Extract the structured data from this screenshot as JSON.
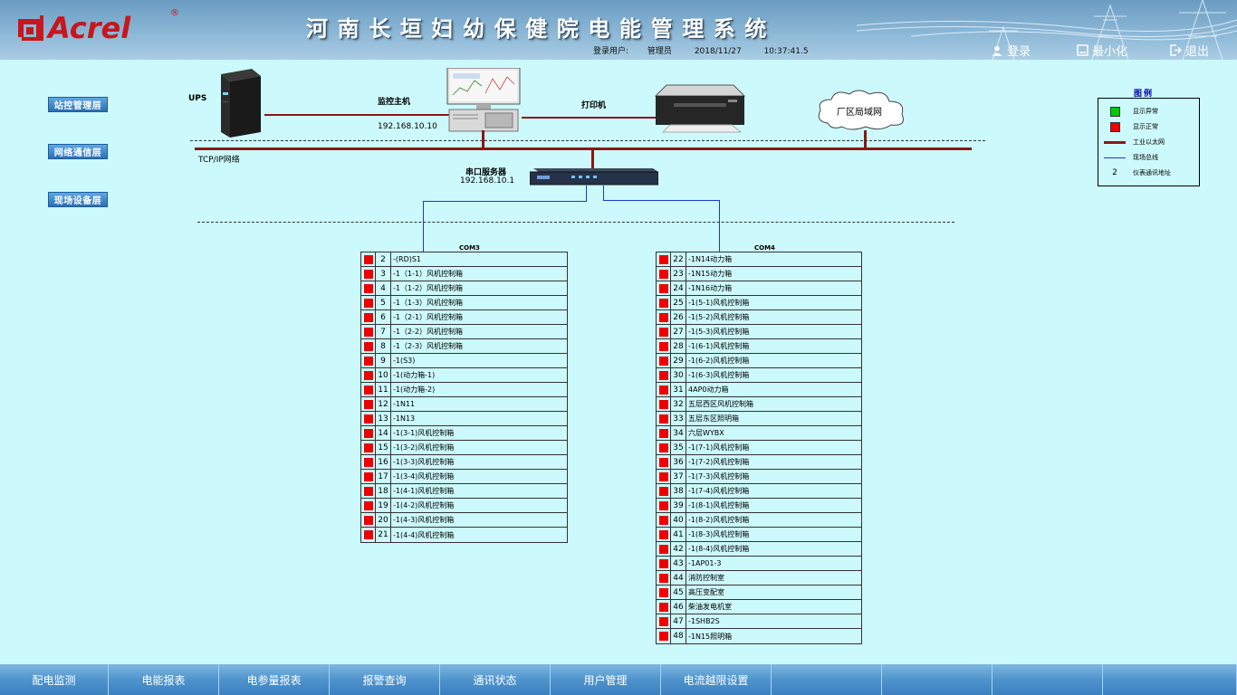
{
  "header": {
    "logo_text": "Acrel",
    "logo_reg": "®",
    "title": "河南长垣妇幼保健院电能管理系统",
    "login_user_label": "登录用户:",
    "login_user": "管理员",
    "date": "2018/11/27",
    "time": "10:37:41.5",
    "buttons": {
      "login": "登录",
      "minimize": "最小化",
      "logout": "退出"
    }
  },
  "layers": [
    "站控管理层",
    "网络通信层",
    "现场设备层"
  ],
  "topology": {
    "ups_label": "UPS",
    "host_label": "监控主机",
    "host_ip": "192.168.10.10",
    "printer_label": "打印机",
    "lan_label": "厂区局域网",
    "tcpip_label": "TCP/IP网络",
    "server_label": "串口服务器",
    "server_ip": "192.168.10.1"
  },
  "com_left": {
    "label": "COM3",
    "rows": [
      {
        "no": "2",
        "name": "-(RD)S1"
      },
      {
        "no": "3",
        "name": "-1（1-1）风机控制箱"
      },
      {
        "no": "4",
        "name": "-1（1-2）风机控制箱"
      },
      {
        "no": "5",
        "name": "-1（1-3）风机控制箱"
      },
      {
        "no": "6",
        "name": "-1（2-1）风机控制箱"
      },
      {
        "no": "7",
        "name": "-1（2-2）风机控制箱"
      },
      {
        "no": "8",
        "name": "-1（2-3）风机控制箱"
      },
      {
        "no": "9",
        "name": "-1(S3)"
      },
      {
        "no": "10",
        "name": "-1(动力箱-1)"
      },
      {
        "no": "11",
        "name": "-1(动力箱-2)"
      },
      {
        "no": "12",
        "name": "-1N11"
      },
      {
        "no": "13",
        "name": "-1N13"
      },
      {
        "no": "14",
        "name": "-1(3-1)风机控制箱"
      },
      {
        "no": "15",
        "name": "-1(3-2)风机控制箱"
      },
      {
        "no": "16",
        "name": "-1(3-3)风机控制箱"
      },
      {
        "no": "17",
        "name": "-1(3-4)风机控制箱"
      },
      {
        "no": "18",
        "name": "-1(4-1)风机控制箱"
      },
      {
        "no": "19",
        "name": "-1(4-2)风机控制箱"
      },
      {
        "no": "20",
        "name": "-1(4-3)风机控制箱"
      },
      {
        "no": "21",
        "name": "-1(4-4)风机控制箱"
      }
    ]
  },
  "com_right": {
    "label": "COM4",
    "rows": [
      {
        "no": "22",
        "name": "-1N14动力箱"
      },
      {
        "no": "23",
        "name": "-1N15动力箱"
      },
      {
        "no": "24",
        "name": "-1N16动力箱"
      },
      {
        "no": "25",
        "name": "-1(5-1)风机控制箱"
      },
      {
        "no": "26",
        "name": "-1(5-2)风机控制箱"
      },
      {
        "no": "27",
        "name": "-1(5-3)风机控制箱"
      },
      {
        "no": "28",
        "name": "-1(6-1)风机控制箱"
      },
      {
        "no": "29",
        "name": "-1(6-2)风机控制箱"
      },
      {
        "no": "30",
        "name": "-1(6-3)风机控制箱"
      },
      {
        "no": "31",
        "name": "4AP0动力箱"
      },
      {
        "no": "32",
        "name": "五层西区风机控制箱"
      },
      {
        "no": "33",
        "name": "五层东区照明箱"
      },
      {
        "no": "34",
        "name": "六层WYBX"
      },
      {
        "no": "35",
        "name": "-1(7-1)风机控制箱"
      },
      {
        "no": "36",
        "name": "-1(7-2)风机控制箱"
      },
      {
        "no": "37",
        "name": "-1(7-3)风机控制箱"
      },
      {
        "no": "38",
        "name": "-1(7-4)风机控制箱"
      },
      {
        "no": "39",
        "name": "-1(8-1)风机控制箱"
      },
      {
        "no": "40",
        "name": "-1(8-2)风机控制箱"
      },
      {
        "no": "41",
        "name": "-1(8-3)风机控制箱"
      },
      {
        "no": "42",
        "name": "-1(8-4)风机控制箱"
      },
      {
        "no": "43",
        "name": "-1AP01-3"
      },
      {
        "no": "44",
        "name": "消防控制室"
      },
      {
        "no": "45",
        "name": "高压变配室"
      },
      {
        "no": "46",
        "name": "柴油发电机室"
      },
      {
        "no": "47",
        "name": "-1SHB2S"
      },
      {
        "no": "48",
        "name": "-1N15照明箱"
      }
    ]
  },
  "legend": {
    "title": "图例",
    "items": [
      {
        "symbol": "green-square",
        "label": "显示异常"
      },
      {
        "symbol": "red-square",
        "label": "显示正常"
      },
      {
        "symbol": "red-line",
        "label": "工业以太网"
      },
      {
        "symbol": "blue-line",
        "label": "现场总线"
      },
      {
        "symbol": "2",
        "label": "仪表通讯地址"
      }
    ]
  },
  "footer_tabs": [
    "配电监测",
    "电能报表",
    "电参量报表",
    "报警查询",
    "通讯状态",
    "用户管理",
    "电流越限设置",
    "",
    "",
    "",
    ""
  ],
  "colors": {
    "status_red": "#ee0000",
    "status_green": "#00cc00",
    "ethernet": "#8b1616",
    "fieldbus": "#1a3cc8"
  }
}
